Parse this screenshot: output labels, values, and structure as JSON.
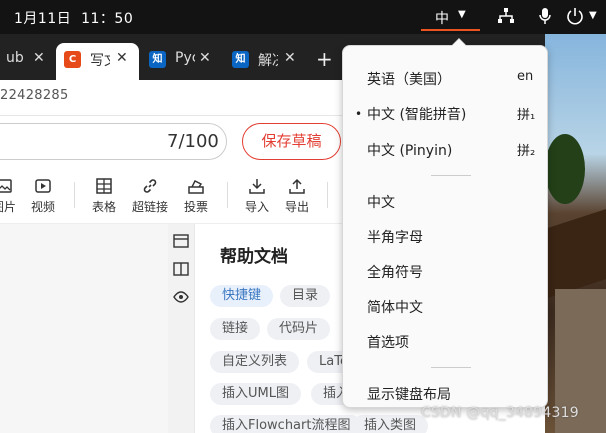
{
  "topbar": {
    "clock": "1月11日  11：50",
    "ime_label": "中",
    "accent": "#e95420"
  },
  "browser": {
    "tabs": [
      {
        "title": "ub",
        "icon": "ubuntu-icon"
      },
      {
        "title": "写文",
        "icon": "csdn-icon",
        "favicon_text": "C",
        "color": "#e64a19"
      },
      {
        "title": "Pyc",
        "icon": "zhihu-icon",
        "favicon_text": "知",
        "color": "#0a66c2"
      },
      {
        "title": "解决",
        "icon": "zhihu-icon",
        "favicon_text": "知",
        "color": "#0a66c2"
      }
    ],
    "url_fragment": "22428285"
  },
  "editor": {
    "char_count": "7/100",
    "save_draft": "保存草稿",
    "toolbar": [
      {
        "label": "图片",
        "icon": "image-icon"
      },
      {
        "label": "视频",
        "icon": "video-icon"
      },
      {
        "label": "表格",
        "icon": "table-icon"
      },
      {
        "label": "超链接",
        "icon": "link-icon"
      },
      {
        "label": "投票",
        "icon": "vote-icon"
      },
      {
        "label": "导入",
        "icon": "import-icon"
      },
      {
        "label": "导出",
        "icon": "export-icon"
      }
    ]
  },
  "help": {
    "title": "帮助文档",
    "chips": [
      "快捷键",
      "目录",
      "链接",
      "代码片",
      "自定义列表",
      "LaTeX",
      "插入UML图",
      "插入",
      "插入Flowchart流程图",
      "插入类图"
    ]
  },
  "ime_menu": {
    "items": [
      {
        "label": "英语（美国）",
        "shortcut": "en",
        "selected": false
      },
      {
        "label": "中文 (智能拼音)",
        "shortcut": "拼₁",
        "selected": true
      },
      {
        "label": "中文 (Pinyin)",
        "shortcut": "拼₂",
        "selected": false
      }
    ],
    "options": [
      "中文",
      "半角字母",
      "全角符号",
      "简体中文",
      "首选项"
    ],
    "footer": "显示键盘布局"
  },
  "watermark": "CSDN @qq_34894319"
}
